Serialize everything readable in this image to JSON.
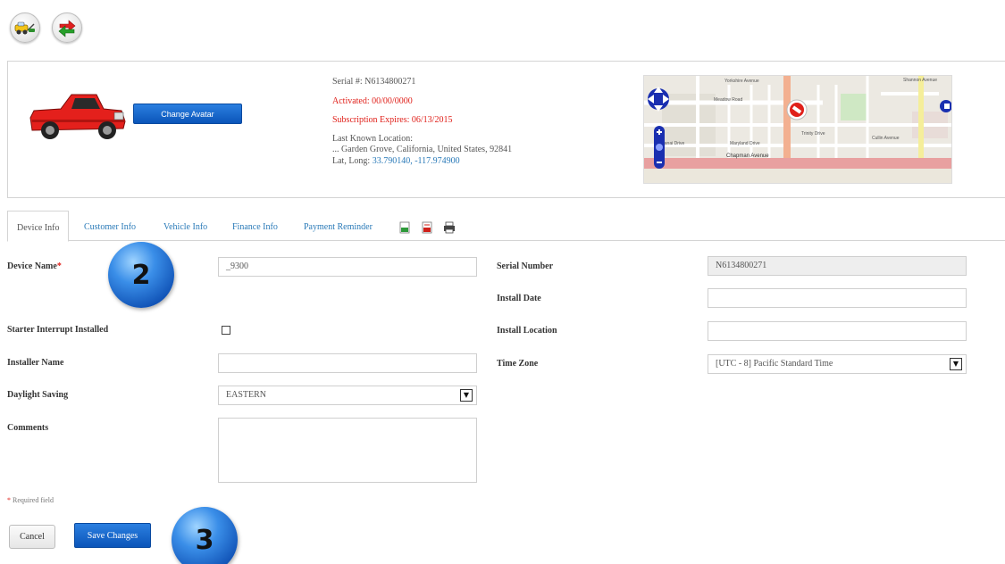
{
  "toolbar": {
    "icons": [
      "tow-truck-icon",
      "transfer-arrows-icon"
    ]
  },
  "vehicle": {
    "change_avatar_label": "Change Avatar",
    "serial_line": "Serial #: N6134800271",
    "activated_line": "Activated: 00/00/0000",
    "subscription_line": "Subscription Expires: 06/13/2015",
    "last_location_label": "Last Known Location:",
    "address": "... Garden Grove, California, United States, 92841",
    "latlong_label": "Lat, Long:",
    "latlong_value": "33.790140, -117.974900"
  },
  "map": {
    "streets": [
      "Yorkshire Avenue",
      "Meadow Road",
      "Lanai Drive",
      "Trinity Drive",
      "Maryland Drive",
      "Chapman Avenue",
      "Shannon Avenue",
      "Cullin Avenue"
    ]
  },
  "tabs": [
    {
      "label": "Device Info",
      "active": true
    },
    {
      "label": "Customer Info",
      "active": false
    },
    {
      "label": "Vehicle Info",
      "active": false
    },
    {
      "label": "Finance Info",
      "active": false
    },
    {
      "label": "Payment Reminder",
      "active": false
    }
  ],
  "tab_icons": [
    "excel-icon",
    "pdf-icon",
    "print-icon"
  ],
  "form": {
    "device_name_label": "Device Name",
    "device_name_value": "_9300",
    "starter_interrupt_label": "Starter Interrupt Installed",
    "starter_interrupt_checked": false,
    "installer_name_label": "Installer Name",
    "installer_name_value": "",
    "daylight_saving_label": "Daylight Saving",
    "daylight_saving_value": "EASTERN",
    "comments_label": "Comments",
    "comments_value": "",
    "serial_number_label": "Serial Number",
    "serial_number_value": "N6134800271",
    "install_date_label": "Install Date",
    "install_date_value": "",
    "install_location_label": "Install Location",
    "install_location_value": "",
    "time_zone_label": "Time Zone",
    "time_zone_value": "[UTC - 8] Pacific Standard Time",
    "required_note": "Required field"
  },
  "actions": {
    "cancel_label": "Cancel",
    "save_label": "Save Changes"
  },
  "badges": {
    "badge_2": "2",
    "badge_3": "3"
  },
  "colors": {
    "accent_blue": "#0b55b9",
    "link_blue": "#2a7ab8",
    "alert_red": "#e0201a"
  }
}
